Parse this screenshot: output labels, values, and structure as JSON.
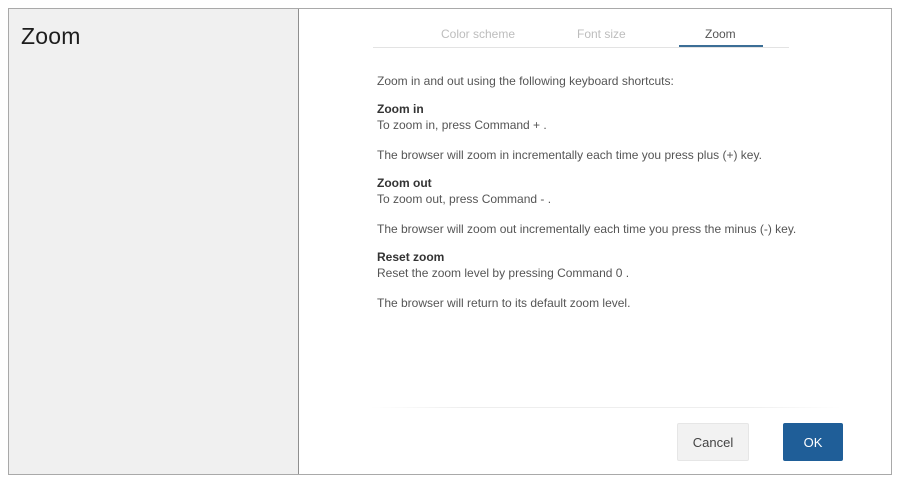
{
  "sidebar": {
    "title": "Zoom"
  },
  "tabs": [
    {
      "label": "Color scheme",
      "active": false
    },
    {
      "label": "Font size",
      "active": false
    },
    {
      "label": "Zoom",
      "active": true
    }
  ],
  "content": {
    "intro": "Zoom in and out using the following keyboard shortcuts:",
    "sections": [
      {
        "title": "Zoom in",
        "shortcut": "To zoom in, press Command + .",
        "description": "The browser will zoom in incrementally each time you press plus (+) key."
      },
      {
        "title": "Zoom out",
        "shortcut": "To zoom out, press Command - .",
        "description": "The browser will zoom out incrementally each time you press the minus (-) key."
      },
      {
        "title": "Reset zoom",
        "shortcut": "Reset the zoom level by pressing Command 0 .",
        "description": "The browser will return to its default zoom level."
      }
    ]
  },
  "buttons": {
    "cancel_label": "Cancel",
    "ok_label": "OK"
  },
  "colors": {
    "accent": "#1f5e98",
    "tab_underline": "#3b6e96",
    "sidebar_bg": "#f0f0f0"
  }
}
